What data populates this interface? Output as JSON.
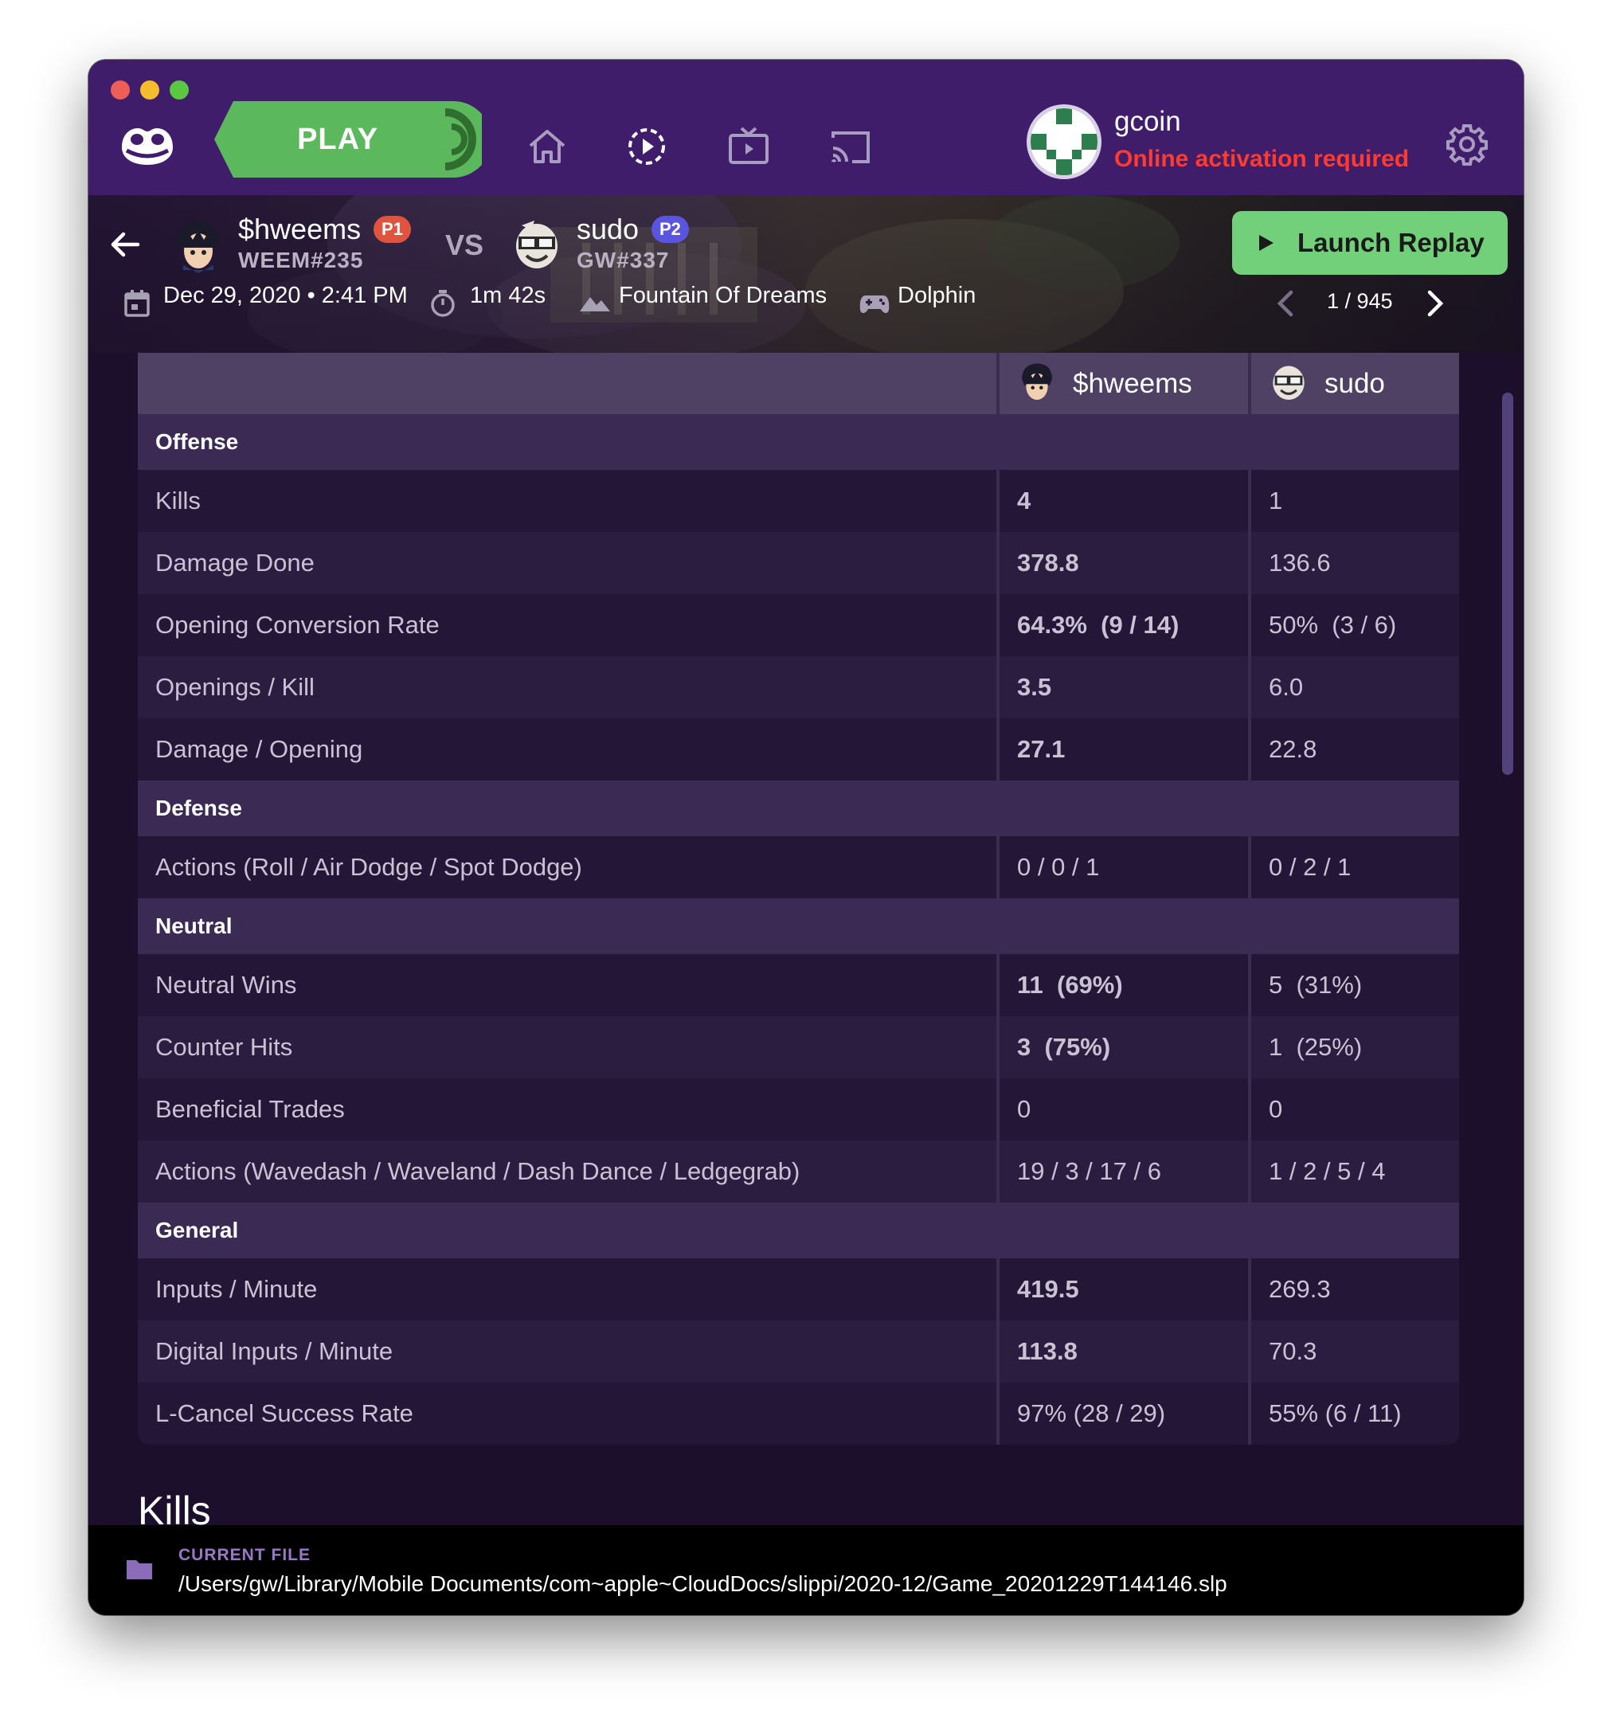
{
  "topbar": {
    "play_label": "PLAY",
    "user": {
      "name": "gcoin",
      "status": "Online activation required"
    },
    "icons": [
      "slippi-logo-icon",
      "home-icon",
      "replays-icon",
      "broadcast-tv-icon",
      "cast-icon",
      "gear-icon"
    ]
  },
  "replay": {
    "player1": {
      "name": "$hweems",
      "tag": "WEEM#235",
      "badge": "P1",
      "badge_color": "#e0533f"
    },
    "vs_label": "VS",
    "player2": {
      "name": "sudo",
      "tag": "GW#337",
      "badge": "P2",
      "badge_color": "#5a55e0"
    },
    "launch_label": "Launch Replay",
    "date": "Dec 29, 2020 • 2:41 PM",
    "duration": "1m 42s",
    "stage": "Fountain Of Dreams",
    "platform": "Dolphin",
    "pager": "1 / 945"
  },
  "stats": {
    "header": {
      "p1": "$hweems",
      "p2": "sudo"
    },
    "sections": [
      {
        "title": "Offense",
        "rows": [
          {
            "label": "Kills",
            "p1": "4",
            "p2": "1",
            "winner": "p1"
          },
          {
            "label": "Damage Done",
            "p1": "378.8",
            "p2": "136.6",
            "winner": "p1"
          },
          {
            "label": "Opening Conversion Rate",
            "p1": "64.3%  (9 / 14)",
            "p2": "50%  (3 / 6)",
            "winner": "p1"
          },
          {
            "label": "Openings / Kill",
            "p1": "3.5",
            "p2": "6.0",
            "winner": "p1"
          },
          {
            "label": "Damage / Opening",
            "p1": "27.1",
            "p2": "22.8",
            "winner": "p1"
          }
        ]
      },
      {
        "title": "Defense",
        "rows": [
          {
            "label": "Actions (Roll / Air Dodge / Spot Dodge)",
            "p1": "0 / 0 / 1",
            "p2": "0 / 2 / 1",
            "winner": ""
          }
        ]
      },
      {
        "title": "Neutral",
        "rows": [
          {
            "label": "Neutral Wins",
            "p1": "11  (69%)",
            "p2": "5  (31%)",
            "winner": "p1"
          },
          {
            "label": "Counter Hits",
            "p1": "3  (75%)",
            "p2": "1  (25%)",
            "winner": "p1"
          },
          {
            "label": "Beneficial Trades",
            "p1": "0",
            "p2": "0",
            "winner": ""
          },
          {
            "label": "Actions (Wavedash / Waveland / Dash Dance / Ledgegrab)",
            "p1": "19 / 3 / 17 / 6",
            "p2": "1 / 2 / 5 / 4",
            "winner": ""
          }
        ]
      },
      {
        "title": "General",
        "rows": [
          {
            "label": "Inputs / Minute",
            "p1": "419.5",
            "p2": "269.3",
            "winner": "p1"
          },
          {
            "label": "Digital Inputs / Minute",
            "p1": "113.8",
            "p2": "70.3",
            "winner": "p1"
          },
          {
            "label": "L-Cancel Success Rate",
            "p1": "97% (28 / 29)",
            "p2": "55% (6 / 11)",
            "winner": ""
          }
        ]
      }
    ]
  },
  "kills_heading": "Kills",
  "footer": {
    "label": "CURRENT FILE",
    "path": "/Users/gw/Library/Mobile Documents/com~apple~CloudDocs/slippi/2020-12/Game_20201229T144146.slp"
  },
  "colors": {
    "accent_yellow": "#ffdd57",
    "play_green": "#5cb85c",
    "launch_green": "#72d07b",
    "warning_red": "#ff3b30"
  }
}
